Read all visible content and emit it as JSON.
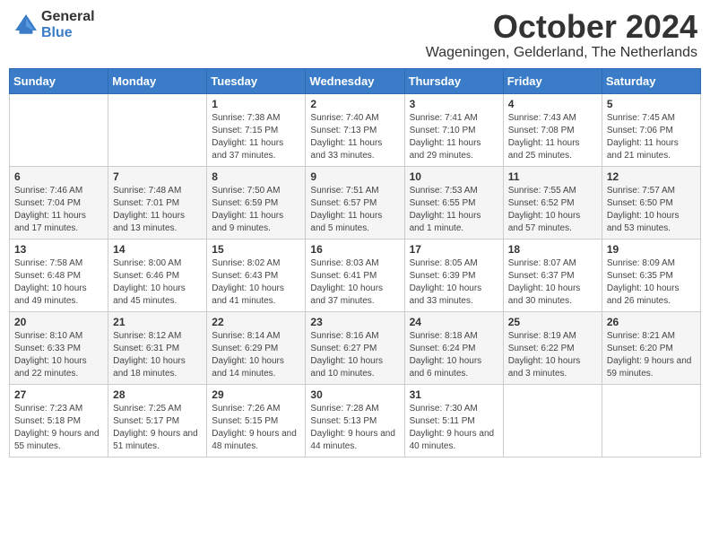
{
  "header": {
    "logo_general": "General",
    "logo_blue": "Blue",
    "month_year": "October 2024",
    "location": "Wageningen, Gelderland, The Netherlands"
  },
  "weekdays": [
    "Sunday",
    "Monday",
    "Tuesday",
    "Wednesday",
    "Thursday",
    "Friday",
    "Saturday"
  ],
  "weeks": [
    [
      {
        "day": "",
        "info": ""
      },
      {
        "day": "",
        "info": ""
      },
      {
        "day": "1",
        "info": "Sunrise: 7:38 AM\nSunset: 7:15 PM\nDaylight: 11 hours and 37 minutes."
      },
      {
        "day": "2",
        "info": "Sunrise: 7:40 AM\nSunset: 7:13 PM\nDaylight: 11 hours and 33 minutes."
      },
      {
        "day": "3",
        "info": "Sunrise: 7:41 AM\nSunset: 7:10 PM\nDaylight: 11 hours and 29 minutes."
      },
      {
        "day": "4",
        "info": "Sunrise: 7:43 AM\nSunset: 7:08 PM\nDaylight: 11 hours and 25 minutes."
      },
      {
        "day": "5",
        "info": "Sunrise: 7:45 AM\nSunset: 7:06 PM\nDaylight: 11 hours and 21 minutes."
      }
    ],
    [
      {
        "day": "6",
        "info": "Sunrise: 7:46 AM\nSunset: 7:04 PM\nDaylight: 11 hours and 17 minutes."
      },
      {
        "day": "7",
        "info": "Sunrise: 7:48 AM\nSunset: 7:01 PM\nDaylight: 11 hours and 13 minutes."
      },
      {
        "day": "8",
        "info": "Sunrise: 7:50 AM\nSunset: 6:59 PM\nDaylight: 11 hours and 9 minutes."
      },
      {
        "day": "9",
        "info": "Sunrise: 7:51 AM\nSunset: 6:57 PM\nDaylight: 11 hours and 5 minutes."
      },
      {
        "day": "10",
        "info": "Sunrise: 7:53 AM\nSunset: 6:55 PM\nDaylight: 11 hours and 1 minute."
      },
      {
        "day": "11",
        "info": "Sunrise: 7:55 AM\nSunset: 6:52 PM\nDaylight: 10 hours and 57 minutes."
      },
      {
        "day": "12",
        "info": "Sunrise: 7:57 AM\nSunset: 6:50 PM\nDaylight: 10 hours and 53 minutes."
      }
    ],
    [
      {
        "day": "13",
        "info": "Sunrise: 7:58 AM\nSunset: 6:48 PM\nDaylight: 10 hours and 49 minutes."
      },
      {
        "day": "14",
        "info": "Sunrise: 8:00 AM\nSunset: 6:46 PM\nDaylight: 10 hours and 45 minutes."
      },
      {
        "day": "15",
        "info": "Sunrise: 8:02 AM\nSunset: 6:43 PM\nDaylight: 10 hours and 41 minutes."
      },
      {
        "day": "16",
        "info": "Sunrise: 8:03 AM\nSunset: 6:41 PM\nDaylight: 10 hours and 37 minutes."
      },
      {
        "day": "17",
        "info": "Sunrise: 8:05 AM\nSunset: 6:39 PM\nDaylight: 10 hours and 33 minutes."
      },
      {
        "day": "18",
        "info": "Sunrise: 8:07 AM\nSunset: 6:37 PM\nDaylight: 10 hours and 30 minutes."
      },
      {
        "day": "19",
        "info": "Sunrise: 8:09 AM\nSunset: 6:35 PM\nDaylight: 10 hours and 26 minutes."
      }
    ],
    [
      {
        "day": "20",
        "info": "Sunrise: 8:10 AM\nSunset: 6:33 PM\nDaylight: 10 hours and 22 minutes."
      },
      {
        "day": "21",
        "info": "Sunrise: 8:12 AM\nSunset: 6:31 PM\nDaylight: 10 hours and 18 minutes."
      },
      {
        "day": "22",
        "info": "Sunrise: 8:14 AM\nSunset: 6:29 PM\nDaylight: 10 hours and 14 minutes."
      },
      {
        "day": "23",
        "info": "Sunrise: 8:16 AM\nSunset: 6:27 PM\nDaylight: 10 hours and 10 minutes."
      },
      {
        "day": "24",
        "info": "Sunrise: 8:18 AM\nSunset: 6:24 PM\nDaylight: 10 hours and 6 minutes."
      },
      {
        "day": "25",
        "info": "Sunrise: 8:19 AM\nSunset: 6:22 PM\nDaylight: 10 hours and 3 minutes."
      },
      {
        "day": "26",
        "info": "Sunrise: 8:21 AM\nSunset: 6:20 PM\nDaylight: 9 hours and 59 minutes."
      }
    ],
    [
      {
        "day": "27",
        "info": "Sunrise: 7:23 AM\nSunset: 5:18 PM\nDaylight: 9 hours and 55 minutes."
      },
      {
        "day": "28",
        "info": "Sunrise: 7:25 AM\nSunset: 5:17 PM\nDaylight: 9 hours and 51 minutes."
      },
      {
        "day": "29",
        "info": "Sunrise: 7:26 AM\nSunset: 5:15 PM\nDaylight: 9 hours and 48 minutes."
      },
      {
        "day": "30",
        "info": "Sunrise: 7:28 AM\nSunset: 5:13 PM\nDaylight: 9 hours and 44 minutes."
      },
      {
        "day": "31",
        "info": "Sunrise: 7:30 AM\nSunset: 5:11 PM\nDaylight: 9 hours and 40 minutes."
      },
      {
        "day": "",
        "info": ""
      },
      {
        "day": "",
        "info": ""
      }
    ]
  ]
}
